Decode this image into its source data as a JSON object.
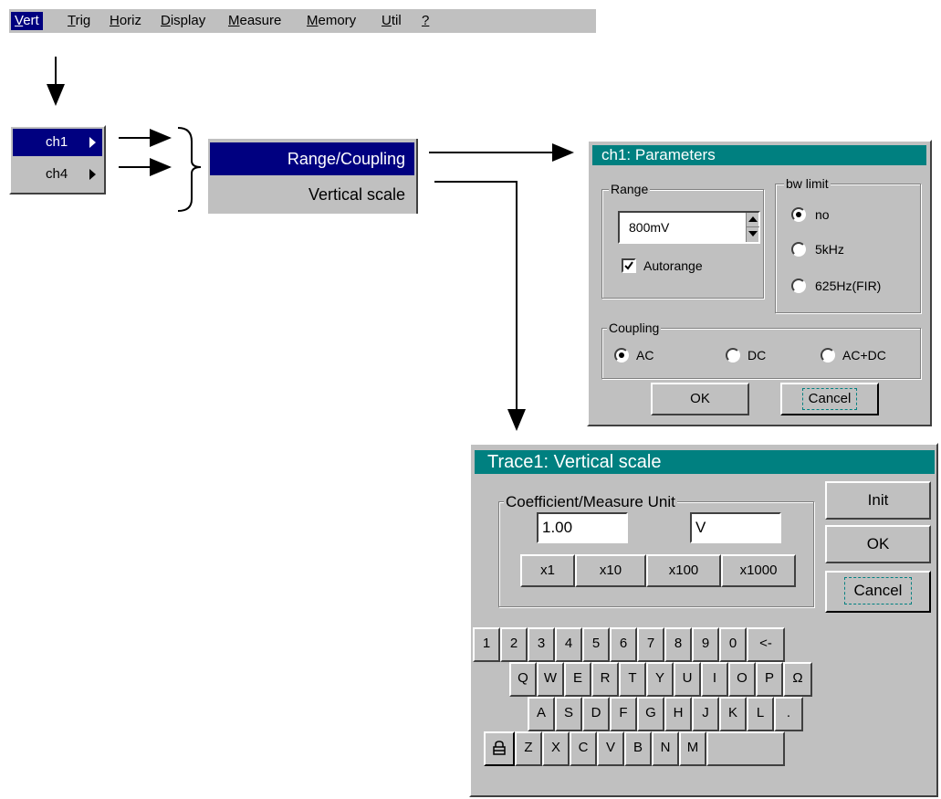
{
  "menubar": {
    "items": [
      {
        "label": "Vert",
        "underline": "V",
        "rest": "ert"
      },
      {
        "label": "Trig",
        "underline": "T",
        "rest": "rig"
      },
      {
        "label": "Horiz",
        "underline": "H",
        "rest": "oriz"
      },
      {
        "label": "Display",
        "underline": "D",
        "rest": "isplay"
      },
      {
        "label": "Measure",
        "underline": "M",
        "rest": "easure"
      },
      {
        "label": "Memory",
        "underline": "M",
        "rest": "emory"
      },
      {
        "label": "Util",
        "underline": "U",
        "rest": "til"
      },
      {
        "label": "?",
        "underline": "?",
        "rest": ""
      }
    ]
  },
  "submenu": {
    "ch1": "ch1",
    "ch4": "ch4"
  },
  "submenu2": {
    "range_coupling": "Range/Coupling",
    "vertical_scale": "Vertical scale"
  },
  "params": {
    "title": "ch1: Parameters",
    "range_legend": "Range",
    "range_value": "800mV",
    "autorange": "Autorange",
    "bw_legend": "bw limit",
    "bw_no": "no",
    "bw_5khz": "5kHz",
    "bw_625": "625Hz(FIR)",
    "coupling_legend": "Coupling",
    "coupling_ac": "AC",
    "coupling_dc": "DC",
    "coupling_acdc": "AC+DC",
    "ok": "OK",
    "cancel": "Cancel"
  },
  "vscale": {
    "title": "Trace1: Vertical scale",
    "group_legend": "Coefficient/Measure Unit",
    "coefficient": "1.00",
    "unit": "V",
    "x1": "x1",
    "x10": "x10",
    "x100": "x100",
    "x1000": "x1000",
    "init": "Init",
    "ok": "OK",
    "cancel": "Cancel"
  },
  "keyboard": {
    "row1": [
      "1",
      "2",
      "3",
      "4",
      "5",
      "6",
      "7",
      "8",
      "9",
      "0",
      "<-"
    ],
    "row2": [
      "Q",
      "W",
      "E",
      "R",
      "T",
      "Y",
      "U",
      "I",
      "O",
      "P",
      "Ω"
    ],
    "row3": [
      "A",
      "S",
      "D",
      "F",
      "G",
      "H",
      "J",
      "K",
      "L",
      "."
    ],
    "row4": [
      "Z",
      "X",
      "C",
      "V",
      "B",
      "N",
      "M"
    ]
  },
  "colors": {
    "title_bar": "#008080",
    "selection": "#000080",
    "panel": "#c0c0c0"
  }
}
